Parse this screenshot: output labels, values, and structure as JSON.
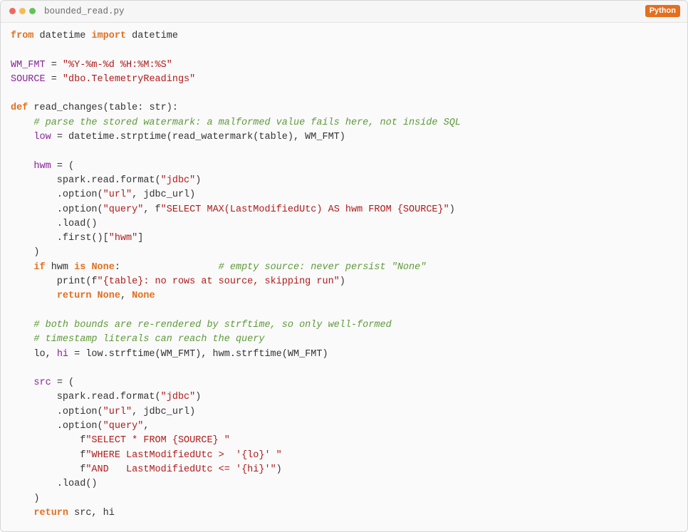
{
  "window": {
    "filename": "bounded_read.py",
    "language": "Python"
  },
  "colors": {
    "keyword": "#e46f1f",
    "variable": "#8a2398",
    "string": "#b11a1a",
    "comment": "#5f9a3a",
    "text": "#333333",
    "badge": "#e46f1f"
  },
  "code": {
    "lines": [
      [
        {
          "t": "kw",
          "v": "from"
        },
        {
          "t": "txt",
          "v": " datetime "
        },
        {
          "t": "kw",
          "v": "import"
        },
        {
          "t": "txt",
          "v": " datetime"
        }
      ],
      [],
      [
        {
          "t": "var",
          "v": "WM_FMT"
        },
        {
          "t": "txt",
          "v": " = "
        },
        {
          "t": "str",
          "v": "\"%Y-%m-%d %H:%M:%S\""
        }
      ],
      [
        {
          "t": "var",
          "v": "SOURCE"
        },
        {
          "t": "txt",
          "v": " = "
        },
        {
          "t": "str",
          "v": "\"dbo.TelemetryReadings\""
        }
      ],
      [],
      [
        {
          "t": "kw",
          "v": "def"
        },
        {
          "t": "txt",
          "v": " read_changes(table: str):"
        }
      ],
      [
        {
          "t": "txt",
          "v": "    "
        },
        {
          "t": "com",
          "v": "# parse the stored watermark: a malformed value fails here, not inside SQL"
        }
      ],
      [
        {
          "t": "txt",
          "v": "    "
        },
        {
          "t": "var",
          "v": "low"
        },
        {
          "t": "txt",
          "v": " = datetime.strptime(read_watermark(table), WM_FMT)"
        }
      ],
      [],
      [
        {
          "t": "txt",
          "v": "    "
        },
        {
          "t": "var",
          "v": "hwm"
        },
        {
          "t": "txt",
          "v": " = ("
        }
      ],
      [
        {
          "t": "txt",
          "v": "        spark.read.format("
        },
        {
          "t": "str",
          "v": "\"jdbc\""
        },
        {
          "t": "txt",
          "v": ")"
        }
      ],
      [
        {
          "t": "txt",
          "v": "        .option("
        },
        {
          "t": "str",
          "v": "\"url\""
        },
        {
          "t": "txt",
          "v": ", jdbc_url)"
        }
      ],
      [
        {
          "t": "txt",
          "v": "        .option("
        },
        {
          "t": "str",
          "v": "\"query\""
        },
        {
          "t": "txt",
          "v": ", f"
        },
        {
          "t": "str",
          "v": "\"SELECT MAX(LastModifiedUtc) AS hwm FROM {SOURCE}\""
        },
        {
          "t": "txt",
          "v": ")"
        }
      ],
      [
        {
          "t": "txt",
          "v": "        .load()"
        }
      ],
      [
        {
          "t": "txt",
          "v": "        .first()["
        },
        {
          "t": "str",
          "v": "\"hwm\""
        },
        {
          "t": "txt",
          "v": "]"
        }
      ],
      [
        {
          "t": "txt",
          "v": "    )"
        }
      ],
      [
        {
          "t": "txt",
          "v": "    "
        },
        {
          "t": "kw",
          "v": "if"
        },
        {
          "t": "txt",
          "v": " hwm "
        },
        {
          "t": "kw",
          "v": "is"
        },
        {
          "t": "txt",
          "v": " "
        },
        {
          "t": "kw",
          "v": "None"
        },
        {
          "t": "txt",
          "v": ":                 "
        },
        {
          "t": "com",
          "v": "# empty source: never persist \"None\""
        }
      ],
      [
        {
          "t": "txt",
          "v": "        print(f"
        },
        {
          "t": "str",
          "v": "\"{table}: no rows at source, skipping run\""
        },
        {
          "t": "txt",
          "v": ")"
        }
      ],
      [
        {
          "t": "txt",
          "v": "        "
        },
        {
          "t": "kw",
          "v": "return"
        },
        {
          "t": "txt",
          "v": " "
        },
        {
          "t": "kw",
          "v": "None"
        },
        {
          "t": "txt",
          "v": ", "
        },
        {
          "t": "kw",
          "v": "None"
        }
      ],
      [],
      [
        {
          "t": "txt",
          "v": "    "
        },
        {
          "t": "com",
          "v": "# both bounds are re-rendered by strftime, so only well-formed"
        }
      ],
      [
        {
          "t": "txt",
          "v": "    "
        },
        {
          "t": "com",
          "v": "# timestamp literals can reach the query"
        }
      ],
      [
        {
          "t": "txt",
          "v": "    lo, "
        },
        {
          "t": "var",
          "v": "hi"
        },
        {
          "t": "txt",
          "v": " = low.strftime(WM_FMT), hwm.strftime(WM_FMT)"
        }
      ],
      [],
      [
        {
          "t": "txt",
          "v": "    "
        },
        {
          "t": "var",
          "v": "src"
        },
        {
          "t": "txt",
          "v": " = ("
        }
      ],
      [
        {
          "t": "txt",
          "v": "        spark.read.format("
        },
        {
          "t": "str",
          "v": "\"jdbc\""
        },
        {
          "t": "txt",
          "v": ")"
        }
      ],
      [
        {
          "t": "txt",
          "v": "        .option("
        },
        {
          "t": "str",
          "v": "\"url\""
        },
        {
          "t": "txt",
          "v": ", jdbc_url)"
        }
      ],
      [
        {
          "t": "txt",
          "v": "        .option("
        },
        {
          "t": "str",
          "v": "\"query\""
        },
        {
          "t": "txt",
          "v": ","
        }
      ],
      [
        {
          "t": "txt",
          "v": "            f"
        },
        {
          "t": "str",
          "v": "\"SELECT * FROM {SOURCE} \""
        }
      ],
      [
        {
          "t": "txt",
          "v": "            f"
        },
        {
          "t": "str",
          "v": "\"WHERE LastModifiedUtc >  '{lo}' \""
        }
      ],
      [
        {
          "t": "txt",
          "v": "            f"
        },
        {
          "t": "str",
          "v": "\"AND   LastModifiedUtc <= '{hi}'\""
        },
        {
          "t": "txt",
          "v": ")"
        }
      ],
      [
        {
          "t": "txt",
          "v": "        .load()"
        }
      ],
      [
        {
          "t": "txt",
          "v": "    )"
        }
      ],
      [
        {
          "t": "txt",
          "v": "    "
        },
        {
          "t": "kw",
          "v": "return"
        },
        {
          "t": "txt",
          "v": " src, hi"
        }
      ]
    ]
  }
}
